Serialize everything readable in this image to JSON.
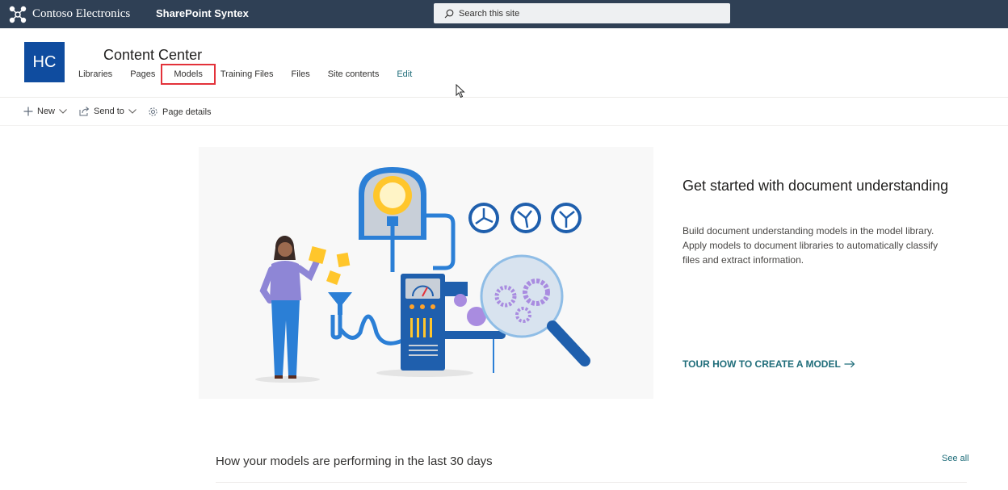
{
  "suite_bar": {
    "org_name": "Contoso Electronics",
    "app_name": "SharePoint Syntex",
    "search_placeholder": "Search this site",
    "background": "#2f4055"
  },
  "site": {
    "logo_initials": "HC",
    "logo_color": "#0f4c9f",
    "title": "Content Center",
    "nav": [
      {
        "label": "Libraries"
      },
      {
        "label": "Pages"
      },
      {
        "label": "Models",
        "highlighted": true
      },
      {
        "label": "Training Files"
      },
      {
        "label": "Files"
      },
      {
        "label": "Site contents"
      },
      {
        "label": "Edit",
        "link": true
      }
    ]
  },
  "command_bar": {
    "new_label": "New",
    "send_to_label": "Send to",
    "page_details_label": "Page details"
  },
  "hero": {
    "title": "Get started with document understanding",
    "description": "Build document understanding models in the model library. Apply models to document libraries to automatically classify files and extract information.",
    "tour_link": "TOUR HOW TO CREATE A MODEL",
    "accent": "#1f6d7a"
  },
  "performance": {
    "title": "How your models are performing in the last 30 days",
    "see_all": "See all"
  },
  "icons": [
    "app-logo-icon",
    "search-icon",
    "plus-icon",
    "chevron-down-icon",
    "share-icon",
    "gear-icon",
    "arrow-right-icon",
    "mouse-cursor-icon"
  ]
}
